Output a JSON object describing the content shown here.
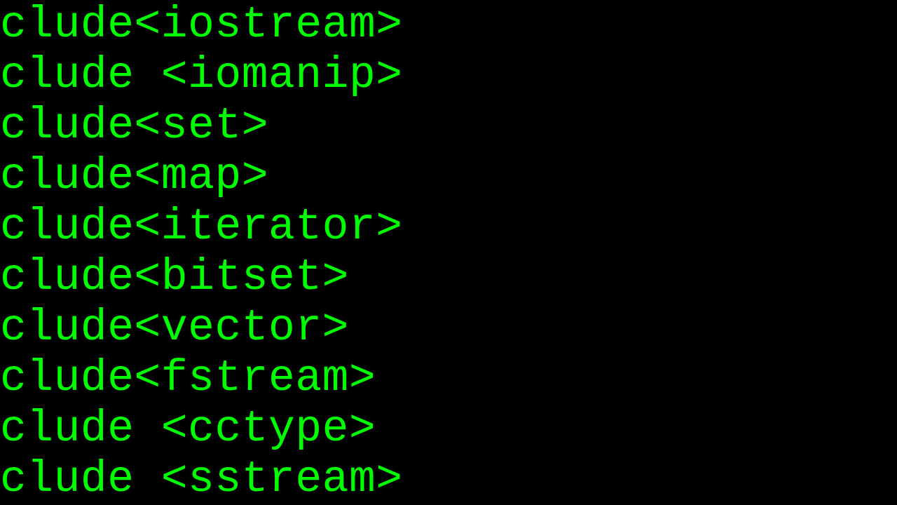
{
  "code": {
    "lines": [
      "clude<iostream>",
      "clude <iomanip>",
      "clude<set>",
      "clude<map>",
      "clude<iterator>",
      "clude<bitset>",
      "clude<vector>",
      "clude<fstream>",
      "clude <cctype>",
      "clude <sstream>"
    ]
  },
  "colors": {
    "background": "#000000",
    "text": "#00ff00"
  }
}
